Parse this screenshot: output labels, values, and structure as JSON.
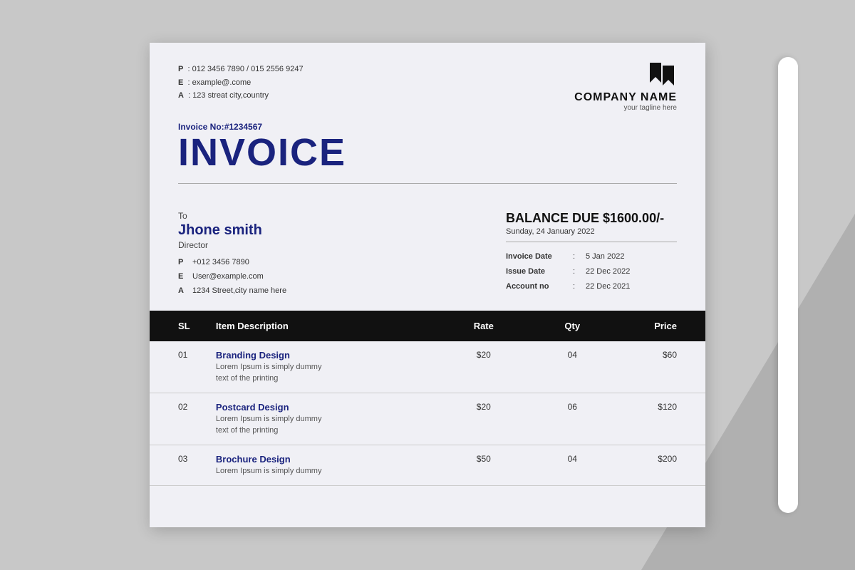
{
  "background": "#c8c8c8",
  "company": {
    "name": "COMPANY NAME",
    "tagline": "your tagline here"
  },
  "contact": {
    "phone_label": "P",
    "phone": "012 3456 7890 / 015 2556 9247",
    "email_label": "E",
    "email": "example@.come",
    "address_label": "A",
    "address": "123 streat city,country"
  },
  "invoice": {
    "number_prefix": "Invoice No:",
    "number": "#1234567",
    "title": "INVOICE"
  },
  "billing": {
    "to_label": "To",
    "client_name": "Jhone smith",
    "client_role": "Director",
    "client_phone_label": "P",
    "client_phone": "+012 3456 7890",
    "client_email_label": "E",
    "client_email": "User@example.com",
    "client_address_label": "A",
    "client_address": "1234 Street,city name here"
  },
  "balance": {
    "label": "BALANCE DUE $1600.00/-",
    "date_label": "Sunday, 24 January 2022"
  },
  "invoice_details": [
    {
      "label": "Invoice Date",
      "value": "5 Jan 2022"
    },
    {
      "label": "Issue Date",
      "value": "22 Dec 2022"
    },
    {
      "label": "Account no",
      "value": "22 Dec 2021"
    }
  ],
  "table": {
    "headers": [
      {
        "key": "sl",
        "label": "SL"
      },
      {
        "key": "description",
        "label": "Item Description"
      },
      {
        "key": "rate",
        "label": "Rate"
      },
      {
        "key": "qty",
        "label": "Qty"
      },
      {
        "key": "price",
        "label": "Price"
      }
    ],
    "rows": [
      {
        "sl": "01",
        "name": "Branding Design",
        "desc": "Lorem Ipsum is simply dummy\ntext of the printing",
        "rate": "$20",
        "qty": "04",
        "price": "$60"
      },
      {
        "sl": "02",
        "name": "Postcard Design",
        "desc": "Lorem Ipsum is simply dummy\ntext of the printing",
        "rate": "$20",
        "qty": "06",
        "price": "$120"
      },
      {
        "sl": "03",
        "name": "Brochure Design",
        "desc": "Lorem Ipsum is simply dummy",
        "rate": "$50",
        "qty": "04",
        "price": "$200"
      }
    ]
  }
}
